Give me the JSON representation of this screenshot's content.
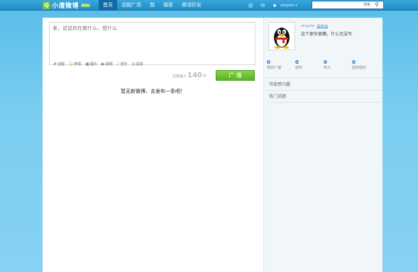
{
  "topbar": {
    "logo_mark": "Q",
    "logo_text": "小清微博",
    "logo_badge": "Beta",
    "nav": [
      "首页",
      "话题广场",
      "我",
      "搜索",
      "邀请好友"
    ],
    "tools": [
      {
        "icon": "at-icon",
        "glyph": "@"
      },
      {
        "icon": "mail-icon",
        "glyph": "✉"
      },
      {
        "icon": "user-icon",
        "glyph": "●"
      }
    ],
    "username": "zingsite ▾",
    "search_placeholder": "搜索"
  },
  "composer": {
    "placeholder": "来，说说你在做什么，想什么",
    "tools": [
      {
        "icon": "topic-icon",
        "glyph": "#",
        "label": "话题"
      },
      {
        "icon": "emoji-icon",
        "glyph": "☺",
        "label": "表情"
      },
      {
        "icon": "image-icon",
        "glyph": "▣",
        "label": "图片"
      },
      {
        "icon": "video-icon",
        "glyph": "▶",
        "label": "视频"
      },
      {
        "icon": "music-icon",
        "glyph": "♪",
        "label": "音乐"
      },
      {
        "icon": "vote-icon",
        "glyph": "◎",
        "label": "投票"
      }
    ],
    "counter_prefix": "还能输入",
    "counter_value": "140",
    "counter_suffix": "字",
    "post_label": "广 播"
  },
  "feed": {
    "empty_message": "暂无新微博，去发布一条吧！"
  },
  "profile": {
    "name": "zingsite",
    "badge": "@zing",
    "tagline": "这个家伙很懒，什么也没写",
    "stats": [
      {
        "value": "0",
        "label": "我的广播"
      },
      {
        "value": "0",
        "label": "收听"
      },
      {
        "value": "0",
        "label": "听众"
      },
      {
        "value": "0",
        "label": "提到我的"
      }
    ],
    "section_1": "可能感兴趣",
    "section_2": "热门话题"
  }
}
